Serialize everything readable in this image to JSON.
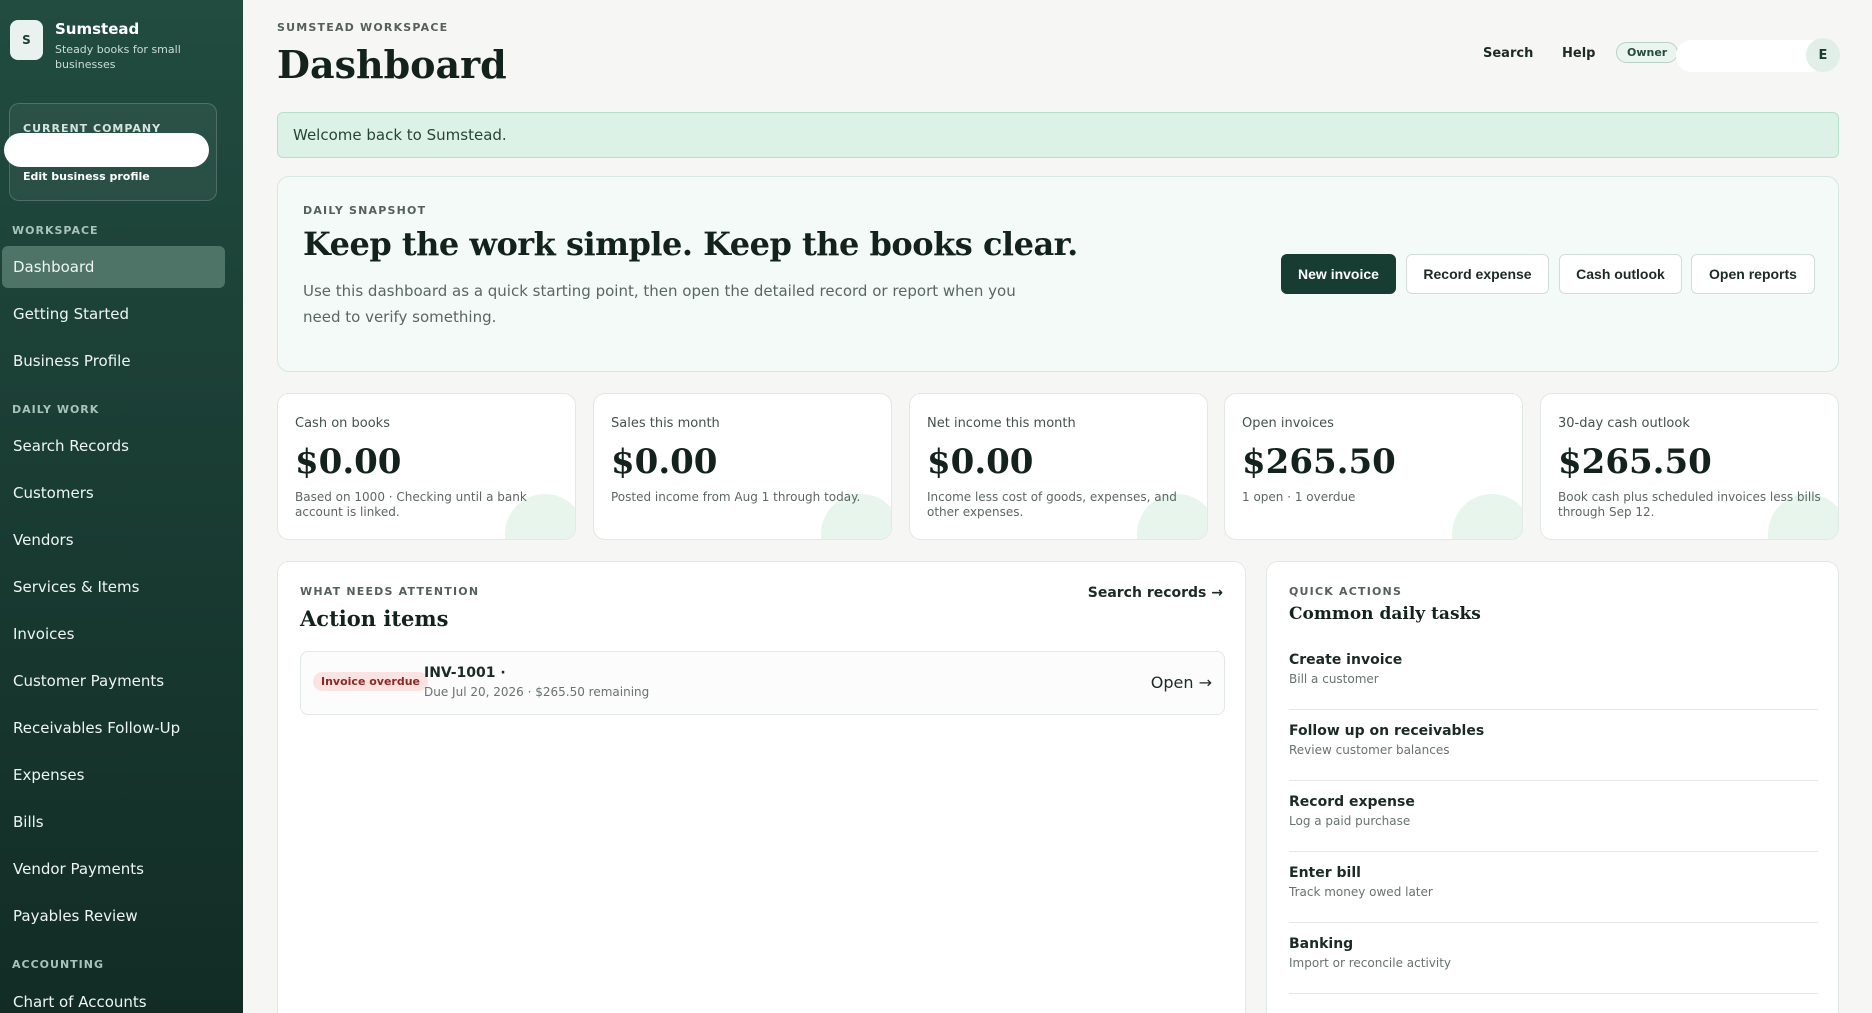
{
  "brand": {
    "logo_letter": "S",
    "name": "Sumstead",
    "tagline": "Steady books for small businesses"
  },
  "company_card": {
    "label": "CURRENT COMPANY",
    "edit_label": "Edit business profile"
  },
  "sidebar": {
    "sections": [
      {
        "label": "WORKSPACE"
      },
      {
        "label": "DAILY WORK"
      },
      {
        "label": "ACCOUNTING"
      }
    ],
    "items": [
      {
        "label": "Dashboard",
        "active": true
      },
      {
        "label": "Getting Started"
      },
      {
        "label": "Business Profile"
      },
      {
        "label": "Search Records"
      },
      {
        "label": "Customers"
      },
      {
        "label": "Vendors"
      },
      {
        "label": "Services & Items"
      },
      {
        "label": "Invoices"
      },
      {
        "label": "Customer Payments"
      },
      {
        "label": "Receivables Follow-Up"
      },
      {
        "label": "Expenses"
      },
      {
        "label": "Bills"
      },
      {
        "label": "Vendor Payments"
      },
      {
        "label": "Payables Review"
      },
      {
        "label": "Chart of Accounts"
      }
    ]
  },
  "header": {
    "workspace_label": "SUMSTEAD WORKSPACE",
    "title": "Dashboard",
    "search_label": "Search",
    "help_label": "Help",
    "role_badge": "Owner",
    "avatar_initial": "E"
  },
  "welcome": {
    "message": "Welcome back to Sumstead."
  },
  "snapshot": {
    "eyebrow": "DAILY SNAPSHOT",
    "title": "Keep the work simple. Keep the books clear.",
    "description": "Use this dashboard as a quick starting point, then open the detailed record or report when you need to verify something.",
    "buttons": [
      "New invoice",
      "Record expense",
      "Cash outlook",
      "Open reports"
    ]
  },
  "kpis": [
    {
      "label": "Cash on books",
      "value": "$0.00",
      "note": "Based on 1000 · Checking until a bank account is linked."
    },
    {
      "label": "Sales this month",
      "value": "$0.00",
      "note": "Posted income from Aug 1 through today."
    },
    {
      "label": "Net income this month",
      "value": "$0.00",
      "note": "Income less cost of goods, expenses, and other expenses."
    },
    {
      "label": "Open invoices",
      "value": "$265.50",
      "note": "1 open · 1 overdue"
    },
    {
      "label": "30-day cash outlook",
      "value": "$265.50",
      "note": "Book cash plus scheduled invoices less bills through Sep 12."
    }
  ],
  "attention": {
    "eyebrow": "WHAT NEEDS ATTENTION",
    "title": "Action items",
    "search_link": "Search records →",
    "items": [
      {
        "badge": "Invoice overdue",
        "title": "INV-1001 ·",
        "subtitle": "Due Jul 20, 2026 · $265.50 remaining",
        "action": "Open →"
      }
    ]
  },
  "quick_actions": {
    "eyebrow": "QUICK ACTIONS",
    "title": "Common daily tasks",
    "items": [
      {
        "title": "Create invoice",
        "subtitle": "Bill a customer"
      },
      {
        "title": "Follow up on receivables",
        "subtitle": "Review customer balances"
      },
      {
        "title": "Record expense",
        "subtitle": "Log a paid purchase"
      },
      {
        "title": "Enter bill",
        "subtitle": "Track money owed later"
      },
      {
        "title": "Banking",
        "subtitle": "Import or reconcile activity"
      }
    ]
  },
  "colors": {
    "sidebar": "#1b4136",
    "primary": "#173c32",
    "accent_soft": "#ddf2e6",
    "danger_soft": "#fbe3e1"
  }
}
